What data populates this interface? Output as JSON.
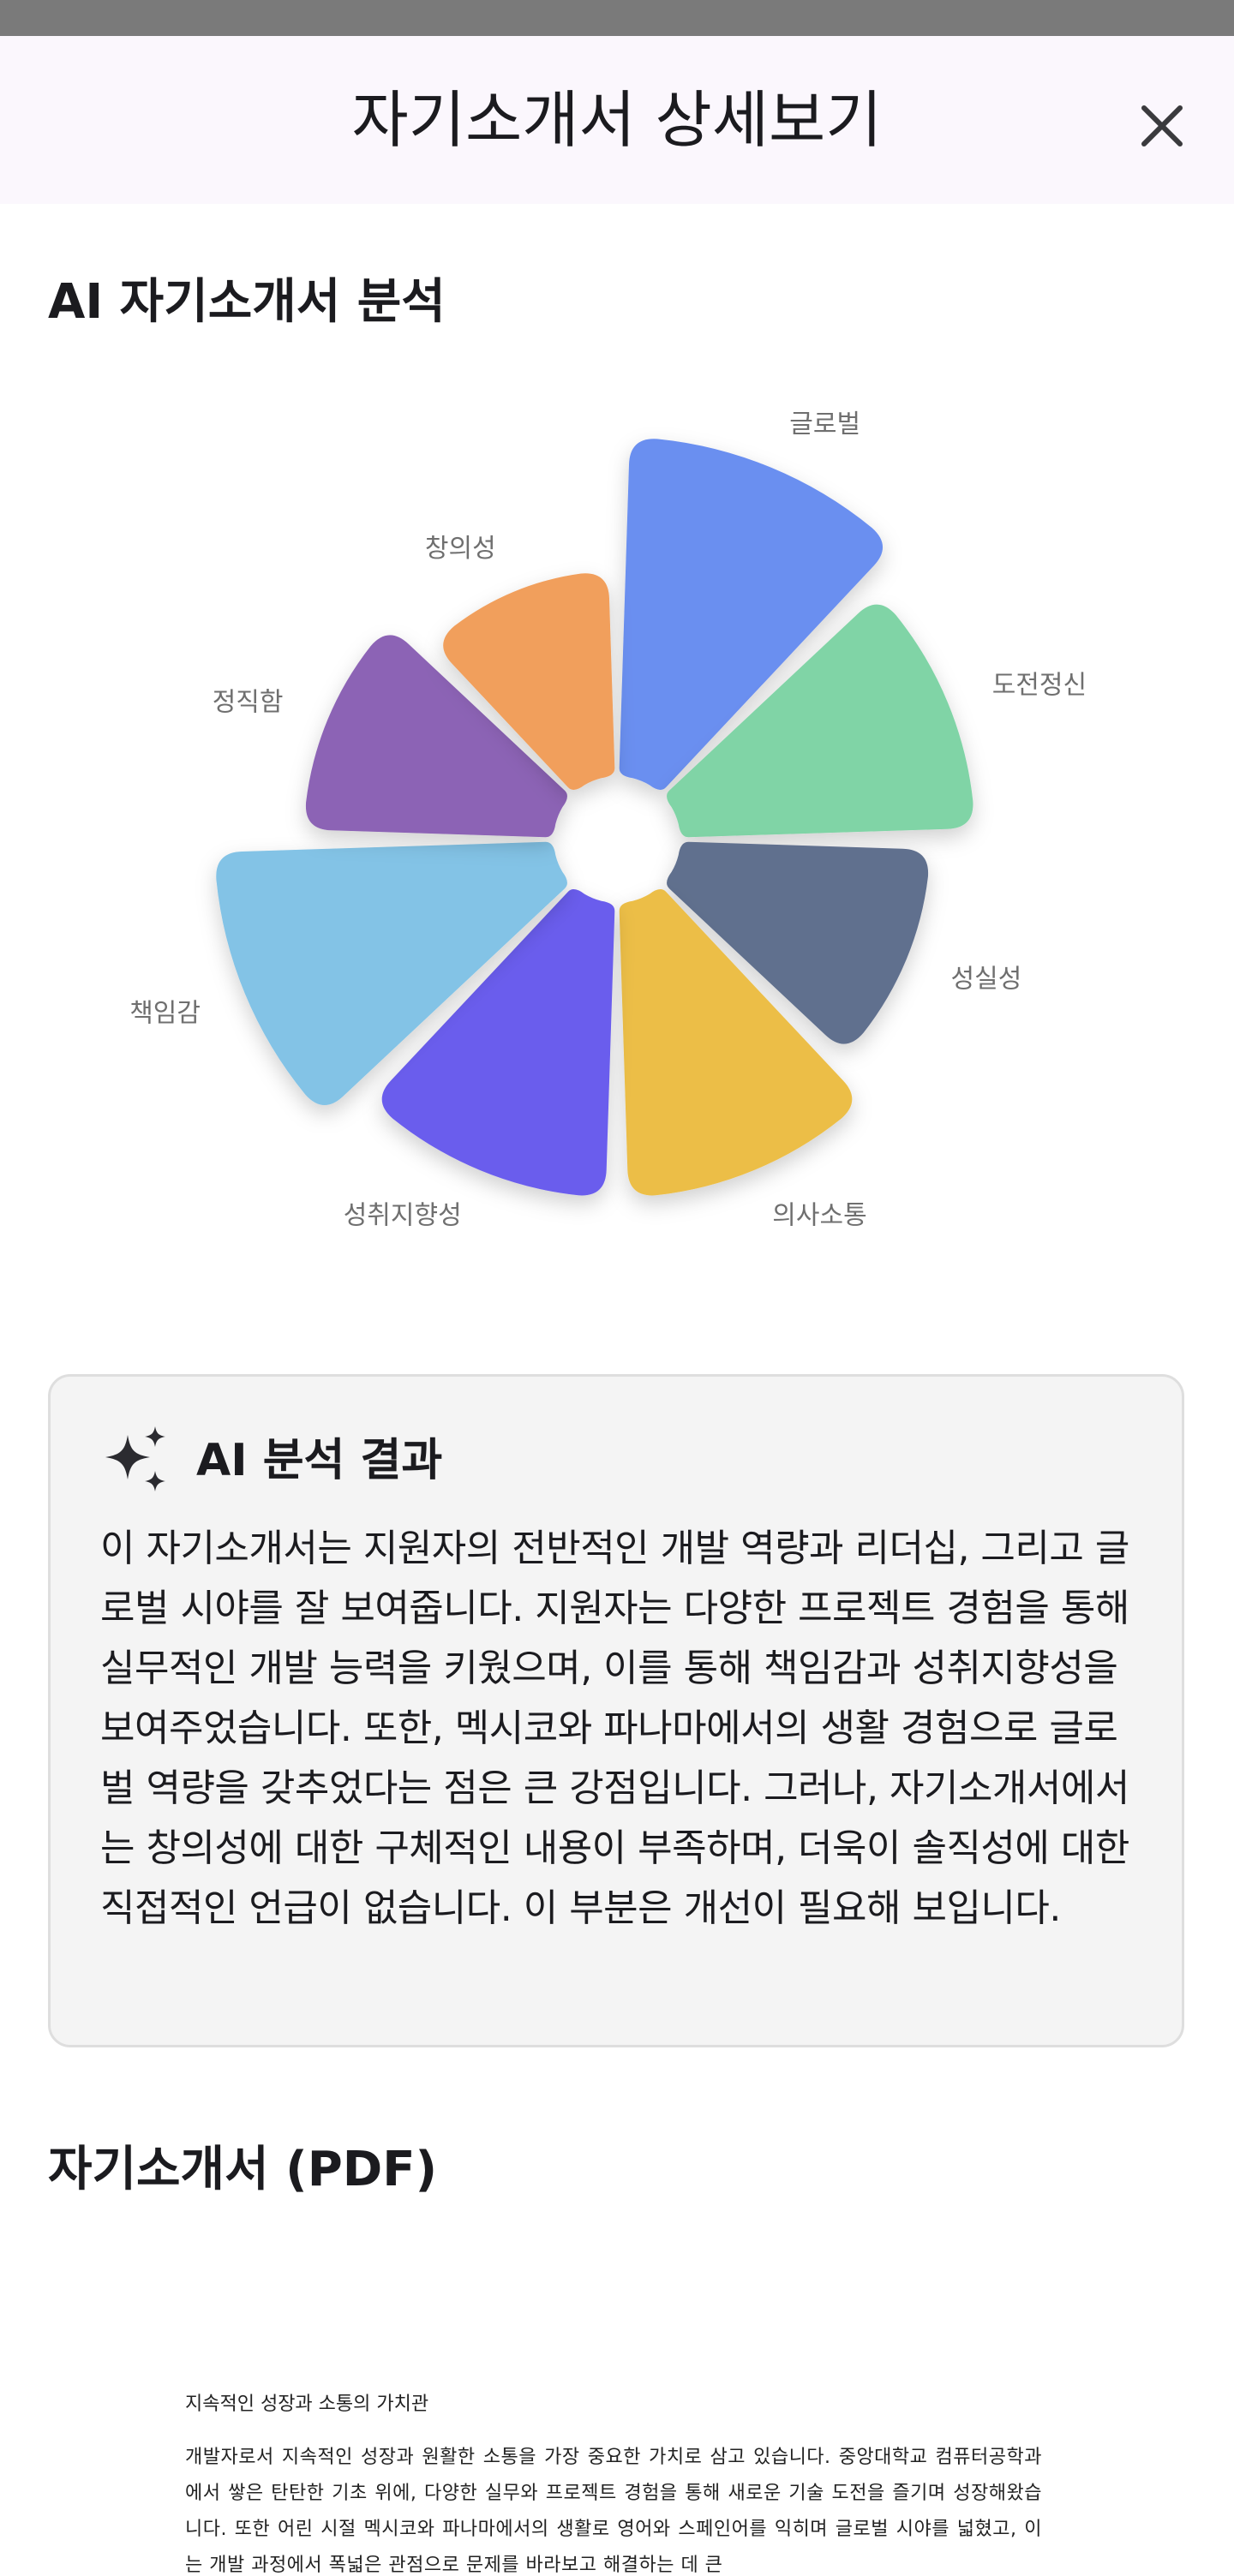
{
  "header": {
    "title": "자기소개서 상세보기"
  },
  "analysis": {
    "section_title": "AI 자기소개서 분석"
  },
  "chart_data": {
    "type": "polar-area",
    "categories": [
      "글로벌",
      "도전정신",
      "성실성",
      "의사소통",
      "성취지향성",
      "책임감",
      "정직함",
      "창의성"
    ],
    "values": [
      9,
      8,
      7,
      8,
      8,
      9,
      7,
      6
    ],
    "colors": [
      "#6a8ff0",
      "#80d4a6",
      "#606f8e",
      "#ecbe47",
      "#6a5ded",
      "#83c3e6",
      "#8c63b5",
      "#f19f5b"
    ],
    "title": "",
    "rmax": 9
  },
  "result": {
    "icon": "sparkle-icon",
    "heading": "AI 분석 결과",
    "text": "이 자기소개서는 지원자의 전반적인 개발 역량과 리더십, 그리고 글로벌 시야를 잘 보여줍니다. 지원자는 다양한 프로젝트 경험을 통해 실무적인 개발 능력을 키웠으며, 이를 통해 책임감과 성취지향성을 보여주었습니다. 또한, 멕시코와 파나마에서의 생활 경험으로 글로벌 역량을 갖추었다는 점은 큰 강점입니다. 그러나, 자기소개서에서는 창의성에 대한 구체적인 내용이 부족하며, 더욱이 솔직성에 대한 직접적인 언급이 없습니다. 이 부분은 개선이 필요해 보입니다."
  },
  "pdf": {
    "section_title": "자기소개서 (PDF)",
    "doc_heading": "지속적인 성장과 소통의 가치관",
    "doc_body": "개발자로서 지속적인 성장과 원활한 소통을 가장 중요한 가치로 삼고 있습니다. 중앙대학교 컴퓨터공학과에서 쌓은 탄탄한 기초 위에, 다양한 실무와 프로젝트 경험을 통해 새로운 기술 도전을 즐기며 성장해왔습니다. 또한 어린 시절 멕시코와 파나마에서의 생활로 영어와 스페인어를 익히며 글로벌 시야를 넓혔고, 이는 개발 과정에서 폭넓은 관점으로 문제를 바라보고 해결하는 데 큰"
  }
}
